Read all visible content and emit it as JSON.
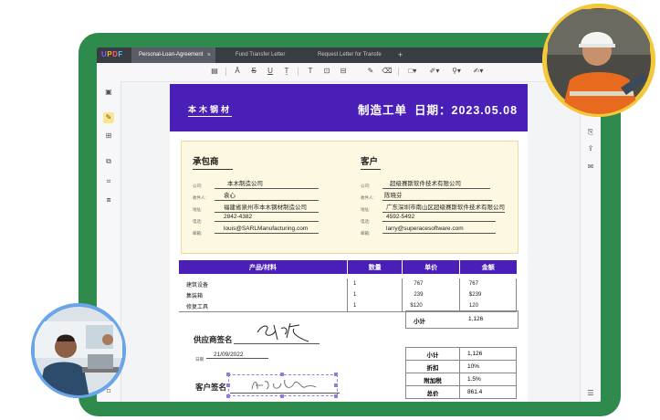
{
  "app": {
    "logo": {
      "u": "U",
      "p": "P",
      "d": "D",
      "f": "F"
    },
    "tabs": [
      {
        "label": "Personal-Loan-Agreement",
        "close": "×",
        "active": true
      },
      {
        "label": "Fund Transfer Letter",
        "active": false
      },
      {
        "label": "Request Letter for Transfe",
        "active": false
      }
    ],
    "new_tab": "+"
  },
  "toolbar": {
    "icons": [
      "comment-icon",
      "highlight-icon",
      "strikethrough-icon",
      "underline-icon",
      "squiggly-icon",
      "text-icon",
      "textbox-icon",
      "text-callout-icon",
      "pencil-icon",
      "eraser-icon",
      "shape-icon",
      "pen-icon",
      "stamp-icon",
      "signature-icon"
    ]
  },
  "document": {
    "header": {
      "brand": "本木钢材",
      "title": "制造工单",
      "date": "日期：2023.05.08"
    },
    "contractor": {
      "heading": "承包商",
      "company_label": "公司:",
      "company": "本木制造公司",
      "recipient_label": "收件人:",
      "recipient": "袁心",
      "address_label": "地址:",
      "address": "福建省泉州市本木钢材制造公司",
      "phone_label": "电话:",
      "phone": "2842-4382",
      "email_label": "邮箱:",
      "email": "louis@SARLManufacturing.com"
    },
    "customer": {
      "heading": "客户",
      "company_label": "公司:",
      "company": "超级赛斯软件技术有限公司",
      "recipient_label": "收件人:",
      "recipient": "陈晓芬",
      "address_label": "地址:",
      "address": "广东深圳市南山区超级赛斯软件技术有限公司",
      "phone_label": "电话:",
      "phone": "4592-5492",
      "email_label": "邮箱:",
      "email": "larry@superacesoftware.com"
    },
    "products": {
      "headers": [
        "产品/材料",
        "数量",
        "单价",
        "金额"
      ],
      "rows": [
        [
          "建筑设备",
          "1",
          "767",
          "767"
        ],
        [
          "集装箱",
          "1",
          "239",
          "$239"
        ],
        [
          "修复工具",
          "1",
          "$120",
          "120"
        ]
      ],
      "subtotal_label": "小计",
      "subtotal": "1,126"
    },
    "signatures": {
      "supplier_label": "供应商签名",
      "date_label": "日期",
      "date": "21/09/2022",
      "customer_label": "客户签名"
    },
    "summary": [
      {
        "label": "小计",
        "value": "1,126"
      },
      {
        "label": "折扣",
        "value": "10%"
      },
      {
        "label": "附加税",
        "value": "1.5%"
      },
      {
        "label": "总价",
        "value": "861.4"
      }
    ]
  }
}
